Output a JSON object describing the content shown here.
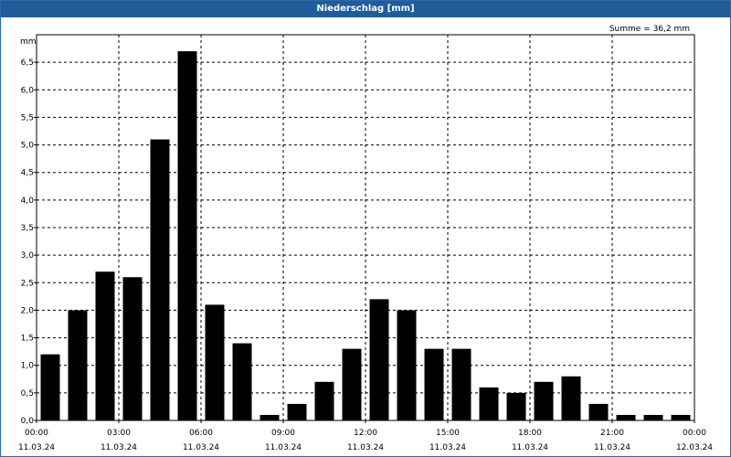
{
  "window": {
    "title": "Niederschlag [mm]"
  },
  "chart_data": {
    "type": "bar",
    "title": "Niederschlag [mm]",
    "ylabel": "mm",
    "annotation": "Summe = 36,2 mm",
    "ylim": [
      0,
      7.0
    ],
    "yticks": [
      "0,0",
      "0,5",
      "1,0",
      "1,5",
      "2,0",
      "2,5",
      "3,0",
      "3,5",
      "4,0",
      "4,5",
      "5,0",
      "5,5",
      "6,0",
      "6,5"
    ],
    "xlim": [
      0,
      24
    ],
    "xticks": [
      {
        "time": "00:00",
        "date": "11.03.24"
      },
      {
        "time": "03:00",
        "date": "11.03.24"
      },
      {
        "time": "06:00",
        "date": "11.03.24"
      },
      {
        "time": "09:00",
        "date": "11.03.24"
      },
      {
        "time": "12:00",
        "date": "11.03.24"
      },
      {
        "time": "15:00",
        "date": "11.03.24"
      },
      {
        "time": "18:00",
        "date": "11.03.24"
      },
      {
        "time": "21:00",
        "date": "11.03.24"
      },
      {
        "time": "00:00",
        "date": "12.03.24"
      }
    ],
    "grid": true,
    "bar_color": "#000000",
    "values": [
      1.2,
      2.0,
      2.7,
      2.6,
      5.1,
      6.7,
      2.1,
      1.4,
      0.1,
      0.3,
      0.7,
      1.3,
      2.2,
      2.0,
      1.3,
      1.3,
      0.6,
      0.5,
      0.7,
      0.8,
      0.3,
      0.1,
      0.1,
      0.1
    ]
  }
}
